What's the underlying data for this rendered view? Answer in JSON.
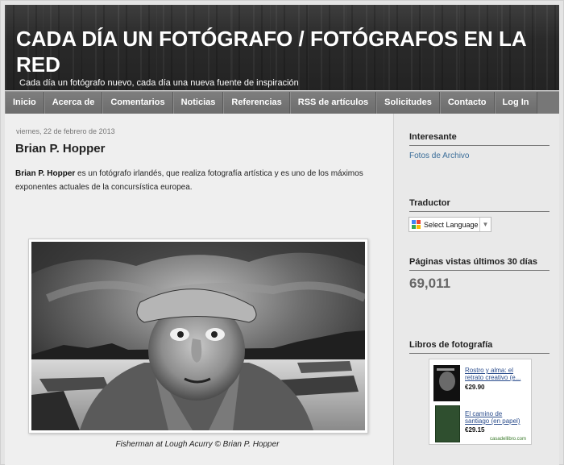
{
  "header": {
    "title": "CADA DÍA UN FOTÓGRAFO / FOTÓGRAFOS EN LA RED",
    "description": "Cada día un fotógrafo nuevo, cada día una nueva fuente de inspiración"
  },
  "nav": {
    "items": [
      "Inicio",
      "Acerca de",
      "Comentarios",
      "Noticias",
      "Referencias",
      "RSS de artículos",
      "Solicitudes",
      "Contacto",
      "Log In"
    ]
  },
  "post": {
    "date": "viernes, 22 de febrero de 2013",
    "title": "Brian P. Hopper",
    "body_name": "Brian P. Hopper",
    "body_text": " es un fotógrafo irlandés, que realiza fotografía artística y es uno de los máximos exponentes actuales de la concursística europea.",
    "photo_caption": "Fisherman at Lough Acurry © Brian P. Hopper"
  },
  "sidebar": {
    "interesante": {
      "title": "Interesante",
      "link": "Fotos de Archivo"
    },
    "traductor": {
      "title": "Traductor",
      "select_label": "Select Language",
      "arrow": "▼"
    },
    "pageviews": {
      "title": "Páginas vistas últimos 30 días",
      "count": "69,011"
    },
    "books": {
      "title": "Libros de fotografía",
      "items": [
        {
          "title": "Rostro y alma: el retrato creativo (e...",
          "price": "€29.90"
        },
        {
          "title": "El camino de santiago (en papel)",
          "price": "€29.15"
        }
      ],
      "store": "casadellibro.com"
    }
  },
  "colors": {
    "nav_bg": "#777777",
    "header_bg": "#2a2a2a",
    "link": "#3a6d99"
  }
}
